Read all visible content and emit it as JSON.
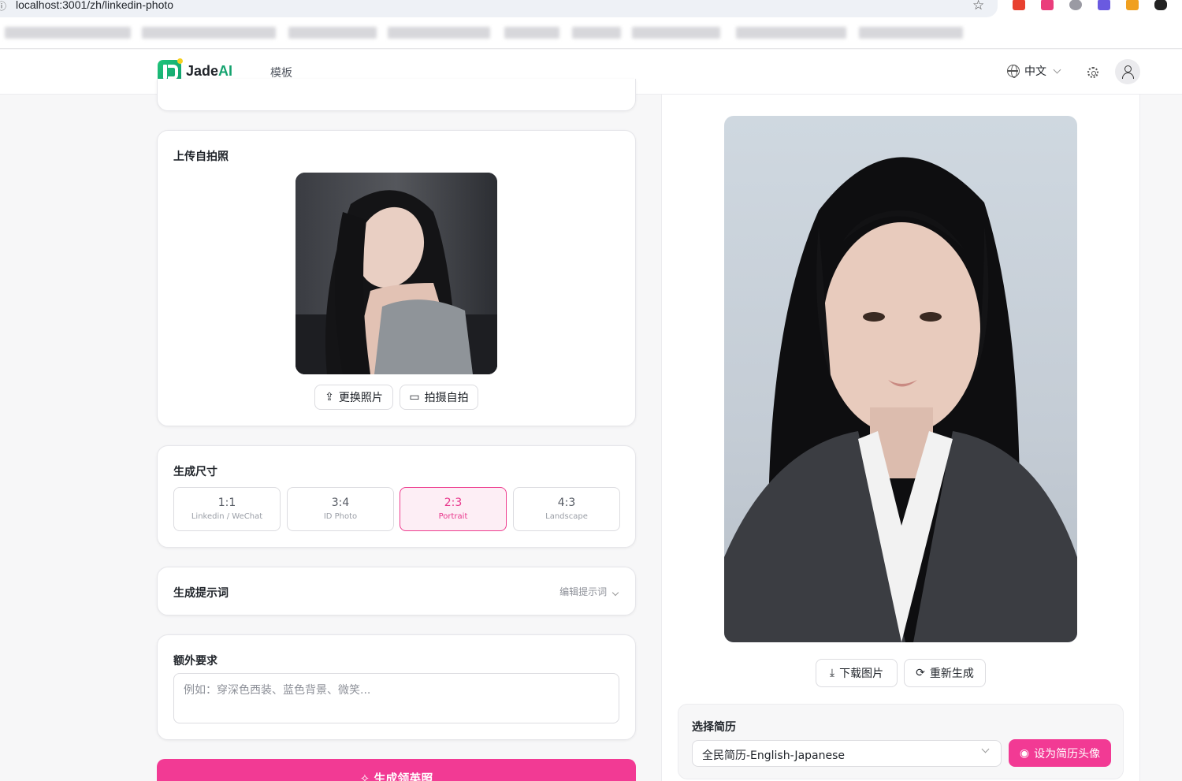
{
  "browser": {
    "url": "localhost:3001/zh/linkedin-photo"
  },
  "header": {
    "logo_prefix": "Jade",
    "logo_suffix": "AI",
    "nav_templates": "模板",
    "language": "中文"
  },
  "upload_card": {
    "title": "上传自拍照",
    "change_photo": "更换照片",
    "take_selfie": "拍摄自拍"
  },
  "size_card": {
    "title": "生成尺寸",
    "options": [
      {
        "ratio": "1:1",
        "label": "Linkedin / WeChat",
        "selected": false
      },
      {
        "ratio": "3:4",
        "label": "ID Photo",
        "selected": false
      },
      {
        "ratio": "2:3",
        "label": "Portrait",
        "selected": true
      },
      {
        "ratio": "4:3",
        "label": "Landscape",
        "selected": false
      }
    ]
  },
  "prompt_card": {
    "title": "生成提示词",
    "edit_label": "编辑提示词"
  },
  "extra_card": {
    "title": "额外要求",
    "placeholder": "例如：穿深色西装、蓝色背景、微笑...",
    "value": ""
  },
  "generate_button": "生成领英照",
  "result": {
    "download": "下载图片",
    "regenerate": "重新生成"
  },
  "resume": {
    "label": "选择简历",
    "selected": "全民简历-English-Japanese",
    "set_avatar": "设为简历头像"
  },
  "colors": {
    "accent_pink": "#f23a94",
    "brand_green": "#15a36f"
  }
}
